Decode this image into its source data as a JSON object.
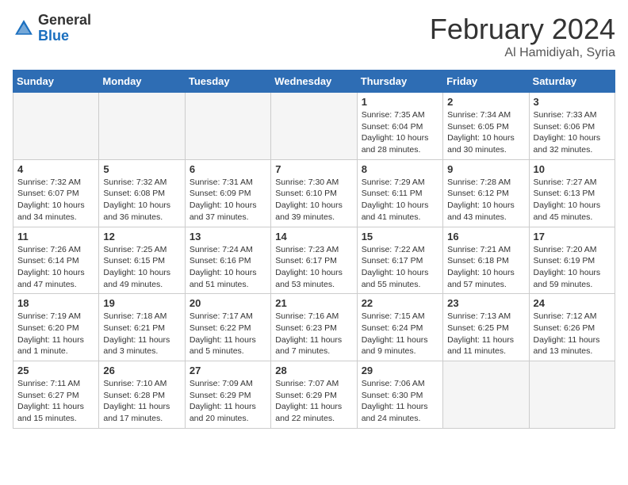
{
  "header": {
    "logo_general": "General",
    "logo_blue": "Blue",
    "month_year": "February 2024",
    "location": "Al Hamidiyah, Syria"
  },
  "days_of_week": [
    "Sunday",
    "Monday",
    "Tuesday",
    "Wednesday",
    "Thursday",
    "Friday",
    "Saturday"
  ],
  "weeks": [
    [
      {
        "day": "",
        "info": ""
      },
      {
        "day": "",
        "info": ""
      },
      {
        "day": "",
        "info": ""
      },
      {
        "day": "",
        "info": ""
      },
      {
        "day": "1",
        "info": "Sunrise: 7:35 AM\nSunset: 6:04 PM\nDaylight: 10 hours\nand 28 minutes."
      },
      {
        "day": "2",
        "info": "Sunrise: 7:34 AM\nSunset: 6:05 PM\nDaylight: 10 hours\nand 30 minutes."
      },
      {
        "day": "3",
        "info": "Sunrise: 7:33 AM\nSunset: 6:06 PM\nDaylight: 10 hours\nand 32 minutes."
      }
    ],
    [
      {
        "day": "4",
        "info": "Sunrise: 7:32 AM\nSunset: 6:07 PM\nDaylight: 10 hours\nand 34 minutes."
      },
      {
        "day": "5",
        "info": "Sunrise: 7:32 AM\nSunset: 6:08 PM\nDaylight: 10 hours\nand 36 minutes."
      },
      {
        "day": "6",
        "info": "Sunrise: 7:31 AM\nSunset: 6:09 PM\nDaylight: 10 hours\nand 37 minutes."
      },
      {
        "day": "7",
        "info": "Sunrise: 7:30 AM\nSunset: 6:10 PM\nDaylight: 10 hours\nand 39 minutes."
      },
      {
        "day": "8",
        "info": "Sunrise: 7:29 AM\nSunset: 6:11 PM\nDaylight: 10 hours\nand 41 minutes."
      },
      {
        "day": "9",
        "info": "Sunrise: 7:28 AM\nSunset: 6:12 PM\nDaylight: 10 hours\nand 43 minutes."
      },
      {
        "day": "10",
        "info": "Sunrise: 7:27 AM\nSunset: 6:13 PM\nDaylight: 10 hours\nand 45 minutes."
      }
    ],
    [
      {
        "day": "11",
        "info": "Sunrise: 7:26 AM\nSunset: 6:14 PM\nDaylight: 10 hours\nand 47 minutes."
      },
      {
        "day": "12",
        "info": "Sunrise: 7:25 AM\nSunset: 6:15 PM\nDaylight: 10 hours\nand 49 minutes."
      },
      {
        "day": "13",
        "info": "Sunrise: 7:24 AM\nSunset: 6:16 PM\nDaylight: 10 hours\nand 51 minutes."
      },
      {
        "day": "14",
        "info": "Sunrise: 7:23 AM\nSunset: 6:17 PM\nDaylight: 10 hours\nand 53 minutes."
      },
      {
        "day": "15",
        "info": "Sunrise: 7:22 AM\nSunset: 6:17 PM\nDaylight: 10 hours\nand 55 minutes."
      },
      {
        "day": "16",
        "info": "Sunrise: 7:21 AM\nSunset: 6:18 PM\nDaylight: 10 hours\nand 57 minutes."
      },
      {
        "day": "17",
        "info": "Sunrise: 7:20 AM\nSunset: 6:19 PM\nDaylight: 10 hours\nand 59 minutes."
      }
    ],
    [
      {
        "day": "18",
        "info": "Sunrise: 7:19 AM\nSunset: 6:20 PM\nDaylight: 11 hours\nand 1 minute."
      },
      {
        "day": "19",
        "info": "Sunrise: 7:18 AM\nSunset: 6:21 PM\nDaylight: 11 hours\nand 3 minutes."
      },
      {
        "day": "20",
        "info": "Sunrise: 7:17 AM\nSunset: 6:22 PM\nDaylight: 11 hours\nand 5 minutes."
      },
      {
        "day": "21",
        "info": "Sunrise: 7:16 AM\nSunset: 6:23 PM\nDaylight: 11 hours\nand 7 minutes."
      },
      {
        "day": "22",
        "info": "Sunrise: 7:15 AM\nSunset: 6:24 PM\nDaylight: 11 hours\nand 9 minutes."
      },
      {
        "day": "23",
        "info": "Sunrise: 7:13 AM\nSunset: 6:25 PM\nDaylight: 11 hours\nand 11 minutes."
      },
      {
        "day": "24",
        "info": "Sunrise: 7:12 AM\nSunset: 6:26 PM\nDaylight: 11 hours\nand 13 minutes."
      }
    ],
    [
      {
        "day": "25",
        "info": "Sunrise: 7:11 AM\nSunset: 6:27 PM\nDaylight: 11 hours\nand 15 minutes."
      },
      {
        "day": "26",
        "info": "Sunrise: 7:10 AM\nSunset: 6:28 PM\nDaylight: 11 hours\nand 17 minutes."
      },
      {
        "day": "27",
        "info": "Sunrise: 7:09 AM\nSunset: 6:29 PM\nDaylight: 11 hours\nand 20 minutes."
      },
      {
        "day": "28",
        "info": "Sunrise: 7:07 AM\nSunset: 6:29 PM\nDaylight: 11 hours\nand 22 minutes."
      },
      {
        "day": "29",
        "info": "Sunrise: 7:06 AM\nSunset: 6:30 PM\nDaylight: 11 hours\nand 24 minutes."
      },
      {
        "day": "",
        "info": ""
      },
      {
        "day": "",
        "info": ""
      }
    ]
  ]
}
